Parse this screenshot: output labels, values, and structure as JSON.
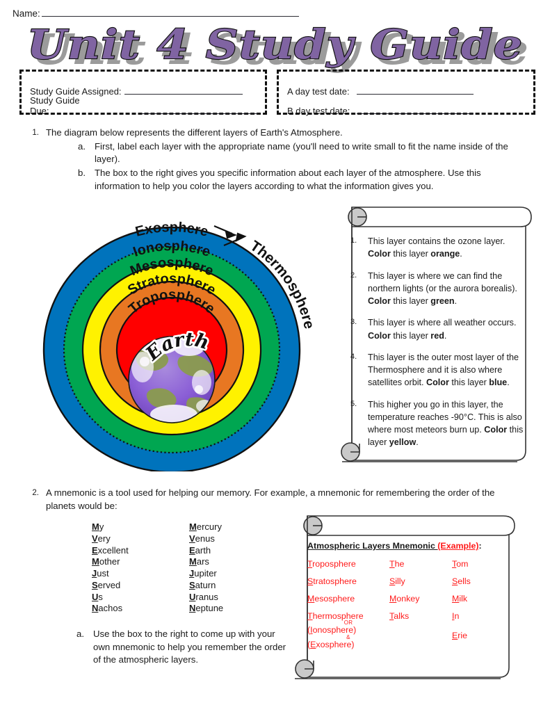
{
  "header": {
    "name_label": "Name:",
    "title": "Unit 4 Study Guide"
  },
  "info_boxes": {
    "left": [
      {
        "label": "Study Guide Assigned:"
      },
      {
        "label": "Study Guide Due:"
      }
    ],
    "right": [
      {
        "label": "A day test date:"
      },
      {
        "label": "B day test date:"
      }
    ]
  },
  "questions": [
    {
      "num": "1.",
      "text": "The diagram below represents the different layers of Earth's Atmosphere.",
      "subs": [
        {
          "num": "a.",
          "text": "First, label each layer with the appropriate name (you'll need to write small to fit the name inside of the layer)."
        },
        {
          "num": "b.",
          "text": "The box to the right gives you specific information about each layer of the atmosphere.  Use this information to help you color the layers according to what the information gives you."
        }
      ]
    },
    {
      "num": "2.",
      "text": "A mnemonic is a tool used for helping our memory.  For example, a mnemonic for remembering the order of the planets would be:",
      "subs": [
        {
          "num": "a.",
          "text": "Use the box to the right to come up with your own mnemonic to help you remember the order of the atmospheric layers."
        }
      ]
    }
  ],
  "diagram": {
    "center_label": "Earth",
    "layers": [
      {
        "name": "Exosphere",
        "color": "#0073bc"
      },
      {
        "name": "Ionosphere",
        "color": "#00a651"
      },
      {
        "name": "Mesosphere",
        "color": "#fff200"
      },
      {
        "name": "Stratosphere",
        "color": "#e87722"
      },
      {
        "name": "Troposphere",
        "color": "#ff0000"
      }
    ],
    "callout": "Thermosphere"
  },
  "info_scroll": {
    "items": [
      {
        "num": "1.",
        "pre": "This layer contains the ozone layer.  ",
        "color_cmd": "Color",
        "mid": " this layer ",
        "color_name": "orange",
        "post": "."
      },
      {
        "num": "2.",
        "pre": "This layer is where we can find the northern lights (or the aurora borealis).  ",
        "color_cmd": "Color",
        "mid": " this layer ",
        "color_name": "green",
        "post": "."
      },
      {
        "num": "3.",
        "pre": "This layer is where all weather occurs.  ",
        "color_cmd": "Color",
        "mid": " this layer ",
        "color_name": "red",
        "post": "."
      },
      {
        "num": "4.",
        "pre": "This layer is the outer most layer of the Thermosphere and it is also where satellites orbit.  ",
        "color_cmd": "Color",
        "mid": " this layer ",
        "color_name": "blue",
        "post": "."
      },
      {
        "num": "5.",
        "pre": "This higher you go in this layer, the temperature reaches -90°C. This is also where most meteors burn up.  ",
        "color_cmd": "Color",
        "mid": " this layer ",
        "color_name": "yellow",
        "post": "."
      }
    ]
  },
  "planet_mnemonic": {
    "rows": [
      {
        "initial": "M",
        "rest": "y",
        "planet_initial": "M",
        "planet_rest": "ercury"
      },
      {
        "initial": "V",
        "rest": "ery",
        "planet_initial": "V",
        "planet_rest": "enus"
      },
      {
        "initial": "E",
        "rest": "xcellent",
        "planet_initial": "E",
        "planet_rest": "arth"
      },
      {
        "initial": "M",
        "rest": "other",
        "planet_initial": "M",
        "planet_rest": "ars"
      },
      {
        "initial": "J",
        "rest": "ust",
        "planet_initial": "J",
        "planet_rest": "upiter"
      },
      {
        "initial": "S",
        "rest": "erved",
        "planet_initial": "S",
        "planet_rest": "aturn"
      },
      {
        "initial": "U",
        "rest": "s",
        "planet_initial": "U",
        "planet_rest": "ranus"
      },
      {
        "initial": "N",
        "rest": "achos",
        "planet_initial": "N",
        "planet_rest": "eptune"
      }
    ]
  },
  "mnemonic_scroll": {
    "title_main": "Atmospheric Layers Mnemonic ",
    "title_example": "(Example)",
    "title_colon": ":",
    "rows": [
      {
        "layer_i": "T",
        "layer_r": "roposphere",
        "w1_i": "T",
        "w1_r": "he",
        "w2_i": "T",
        "w2_r": "om"
      },
      {
        "layer_i": "S",
        "layer_r": "tratosphere",
        "w1_i": "S",
        "w1_r": "illy",
        "w2_i": "S",
        "w2_r": "ells"
      },
      {
        "layer_i": "M",
        "layer_r": "esosphere",
        "w1_i": "M",
        "w1_r": "onkey",
        "w2_i": "M",
        "w2_r": "ilk"
      },
      {
        "layer_i": "T",
        "layer_r": "hermosphere",
        "w1_i": "T",
        "w1_r": "alks",
        "w2_i": "I",
        "w2_r": "n"
      }
    ],
    "or_label": "OR",
    "amp_label": "&",
    "alt1_i": "I",
    "alt1_r": "onosphere",
    "alt2_i": "E",
    "alt2_r": "xosphere",
    "last_i": "E",
    "last_r": "rie"
  },
  "colors": {
    "title_purple": "#8064a2",
    "red_text": "#ff1a1a",
    "ring_blue": "#0073bc",
    "ring_green": "#00a651",
    "ring_yellow": "#fff200",
    "ring_orange": "#e87722",
    "ring_red": "#ff0000"
  }
}
